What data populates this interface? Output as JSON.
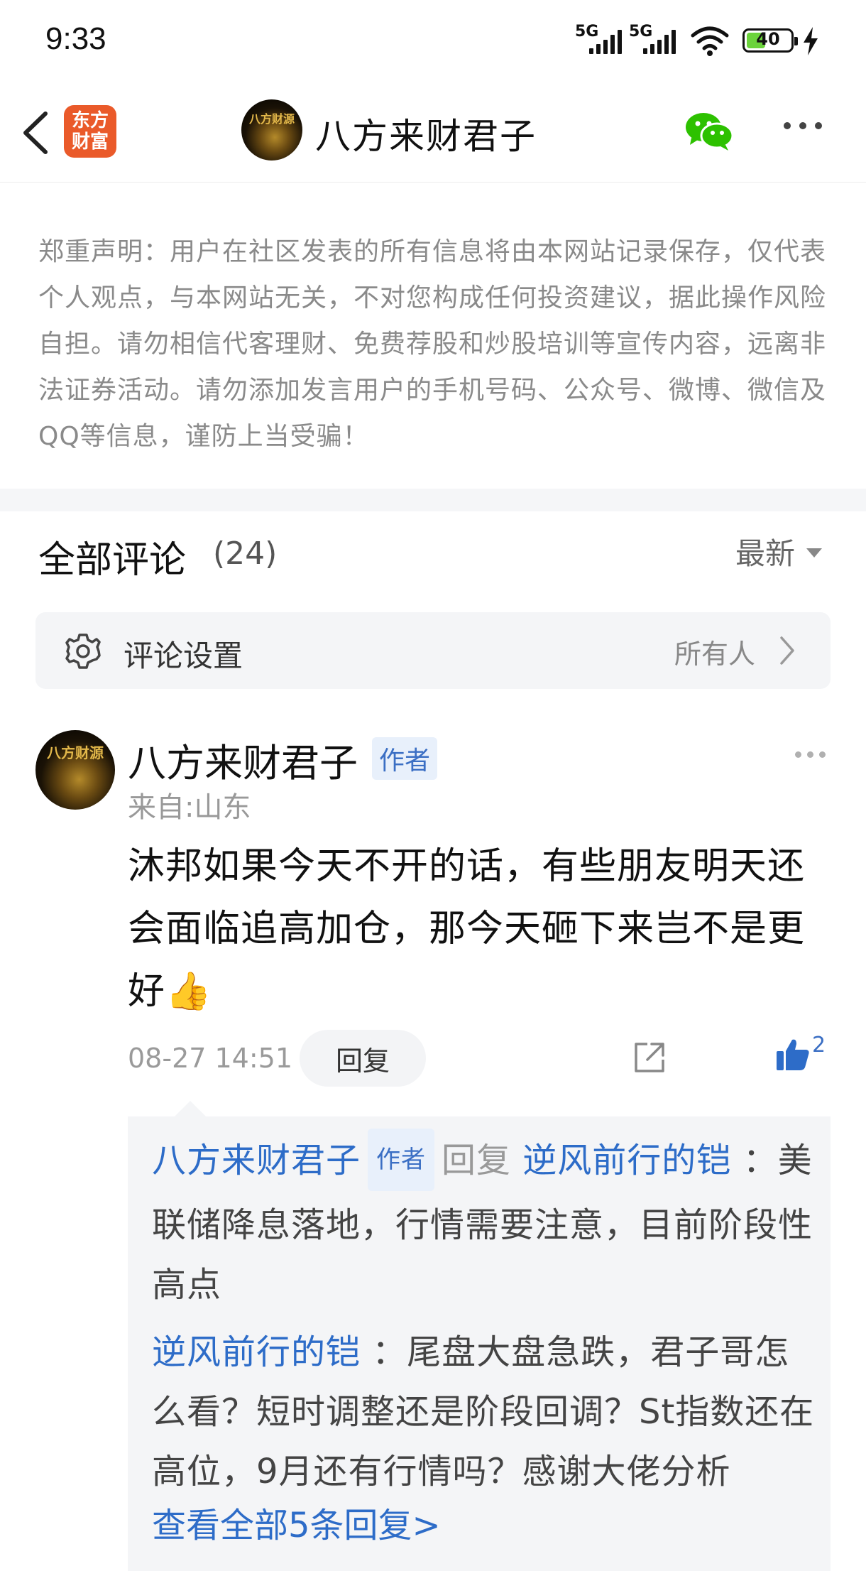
{
  "status_bar": {
    "time": "9:33",
    "network1": "5G",
    "network2": "5G",
    "battery": "40",
    "icons": [
      "signal-icon",
      "wifi-icon",
      "battery-icon",
      "charging-icon"
    ]
  },
  "header": {
    "app_logo_line1": "东方",
    "app_logo_line2": "财富",
    "avatar_text": "八方财源",
    "title": "八方来财君子",
    "icons": [
      "back-icon",
      "wechat-icon",
      "more-icon"
    ]
  },
  "notice": {
    "text": "郑重声明：用户在社区发表的所有信息将由本网站记录保存，仅代表个人观点，与本网站无关，不对您构成任何投资建议，据此操作风险自担。请勿相信代客理财、免费荐股和炒股培训等宣传内容，远离非法证券活动。请勿添加发言用户的手机号码、公众号、微博、微信及QQ等信息，谨防上当受骗！"
  },
  "comments": {
    "title": "全部评论",
    "count": "(24)",
    "sort_label": "最新",
    "settings_label": "评论设置",
    "settings_value": "所有人",
    "items": [
      {
        "avatar_text": "八方财源",
        "author": "八方来财君子",
        "badge": "作者",
        "location": "来自:山东",
        "text": "沐邦如果今天不开的话，有些朋友明天还会面临追高加仓，那今天砸下来岂不是更好👍",
        "time": "08-27 14:51",
        "reply_label": "回复",
        "likes": "2",
        "replies": [
          {
            "from": "八方来财君子",
            "badge": "作者",
            "verb": "回复",
            "to": "逆风前行的铠",
            "sep": "：",
            "text": "美联储降息落地，行情需要注意，目前阶段性高点"
          },
          {
            "from": "逆风前行的铠",
            "sep": "：",
            "text": "尾盘大盘急跌，君子哥怎么看？短时调整还是阶段回调？St指数还在高位，9月还有行情吗？感谢大佬分析"
          }
        ],
        "view_all_replies": "查看全部5条回复>"
      }
    ]
  }
}
